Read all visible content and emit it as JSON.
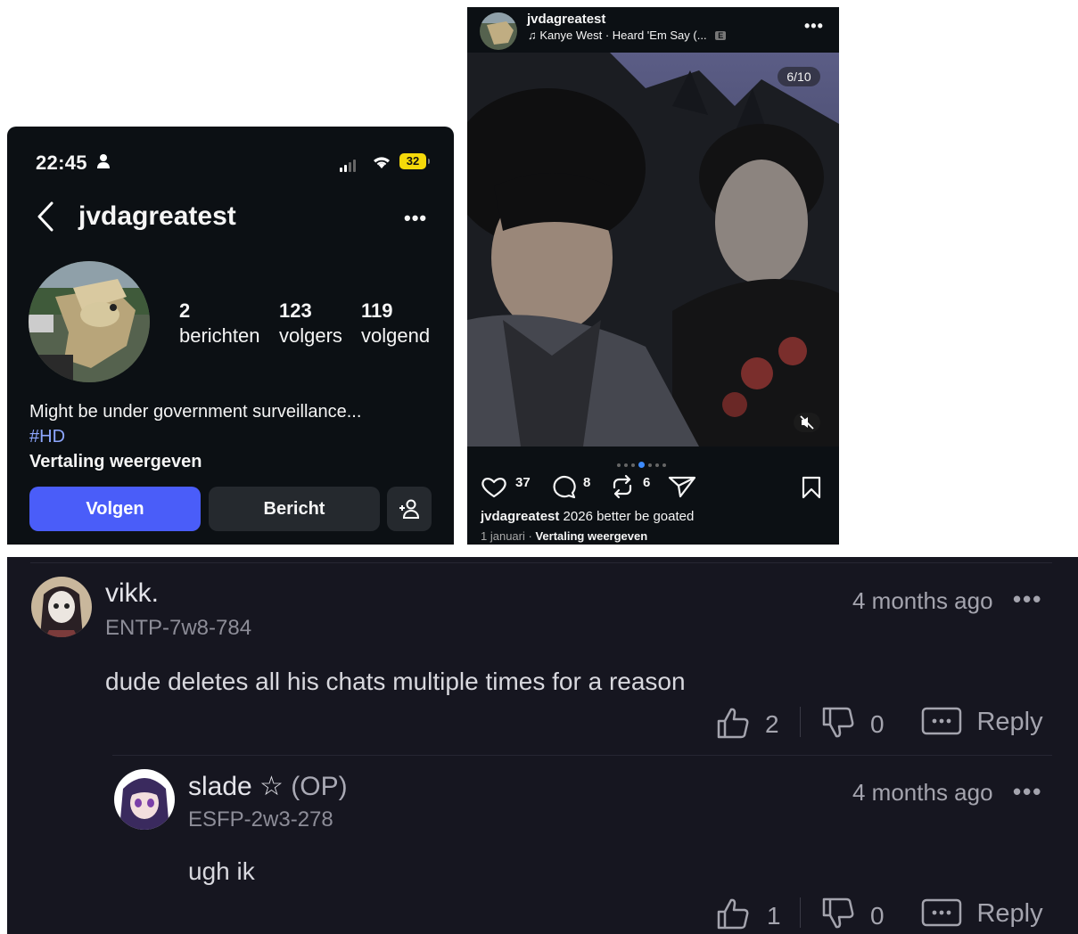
{
  "profile": {
    "status": {
      "time": "22:45",
      "battery": "32"
    },
    "username": "jvdagreatest",
    "stats": [
      {
        "number": "2",
        "label": "berichten"
      },
      {
        "number": "123",
        "label": "volgers"
      },
      {
        "number": "119",
        "label": "volgend"
      }
    ],
    "bio": "Might be under government surveillance...",
    "hashtag": "#HD",
    "translate": "Vertaling weergeven",
    "follow_label": "Volgen",
    "message_label": "Bericht"
  },
  "post": {
    "username": "jvdagreatest",
    "music": "Kanye West · Heard 'Em Say (...",
    "explicit_badge": "E",
    "counter": "6/10",
    "likes": "37",
    "comments": "8",
    "reposts": "6",
    "caption_user": "jvdagreatest",
    "caption_text": "2026 better be goated",
    "date": "1 januari",
    "date_sep": "·",
    "translate": "Vertaling weergeven",
    "carousel": {
      "total": 7,
      "active": 4
    }
  },
  "comments": [
    {
      "name": "vikk.",
      "op": "",
      "tag": "ENTP-7w8-784",
      "time": "4 months ago",
      "text": "dude deletes all his chats multiple times for a reason",
      "likes": "2",
      "dislikes": "0",
      "reply_label": "Reply"
    },
    {
      "name": "slade ☆",
      "op": "(OP)",
      "tag": "ESFP-2w3-278",
      "time": "4 months ago",
      "text": "ugh ik",
      "likes": "1",
      "dislikes": "0",
      "reply_label": "Reply"
    }
  ],
  "icons": {
    "more": "more-horizontal-icon",
    "like": "thumbs-up-icon",
    "dislike": "thumbs-down-icon",
    "reply": "chat-bubble-icon"
  },
  "colors": {
    "follow_button": "#4a5df9",
    "hashtag": "#8ea7ff",
    "carousel_active": "#3d8bfd",
    "battery": "#f5d90a"
  }
}
